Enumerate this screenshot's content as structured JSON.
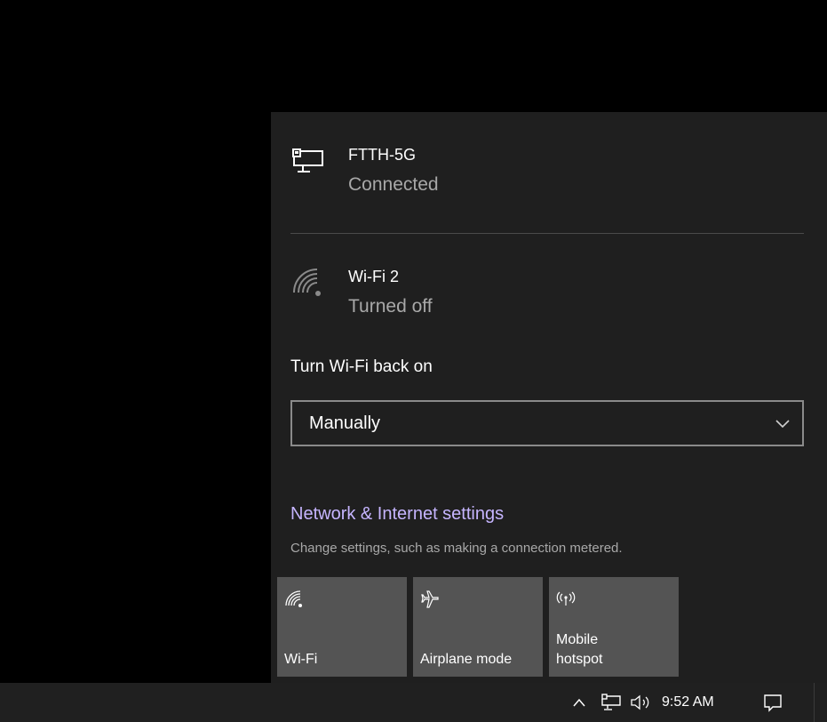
{
  "flyout": {
    "networks": [
      {
        "name": "FTTH-5G",
        "status": "Connected",
        "icon": "ethernet-monitor-icon"
      },
      {
        "name": "Wi-Fi 2",
        "status": "Turned off",
        "icon": "wifi-off-icon"
      }
    ],
    "turn_back_label": "Turn Wi-Fi back on",
    "turn_back_select": {
      "value": "Manually",
      "icon": "chevron-down-icon"
    },
    "settings_link": "Network & Internet settings",
    "settings_description": "Change settings, such as making a connection metered.",
    "quick_actions": [
      {
        "label": "Wi-Fi",
        "icon": "wifi-icon"
      },
      {
        "label": "Airplane mode",
        "icon": "airplane-icon"
      },
      {
        "label": "Mobile\nhotspot",
        "icon": "mobile-hotspot-icon"
      }
    ]
  },
  "taskbar": {
    "tray_icons": [
      "show-hidden-icons-chevron-icon",
      "network-icon",
      "volume-icon"
    ],
    "clock": "9:52 AM",
    "notification_icon": "action-center-icon"
  },
  "colors": {
    "flyout_bg": "#1f1f1f",
    "tile_bg": "#545454",
    "link": "#c6b5ff",
    "secondary_text": "#a8a8a8",
    "taskbar_bg": "#202020"
  }
}
